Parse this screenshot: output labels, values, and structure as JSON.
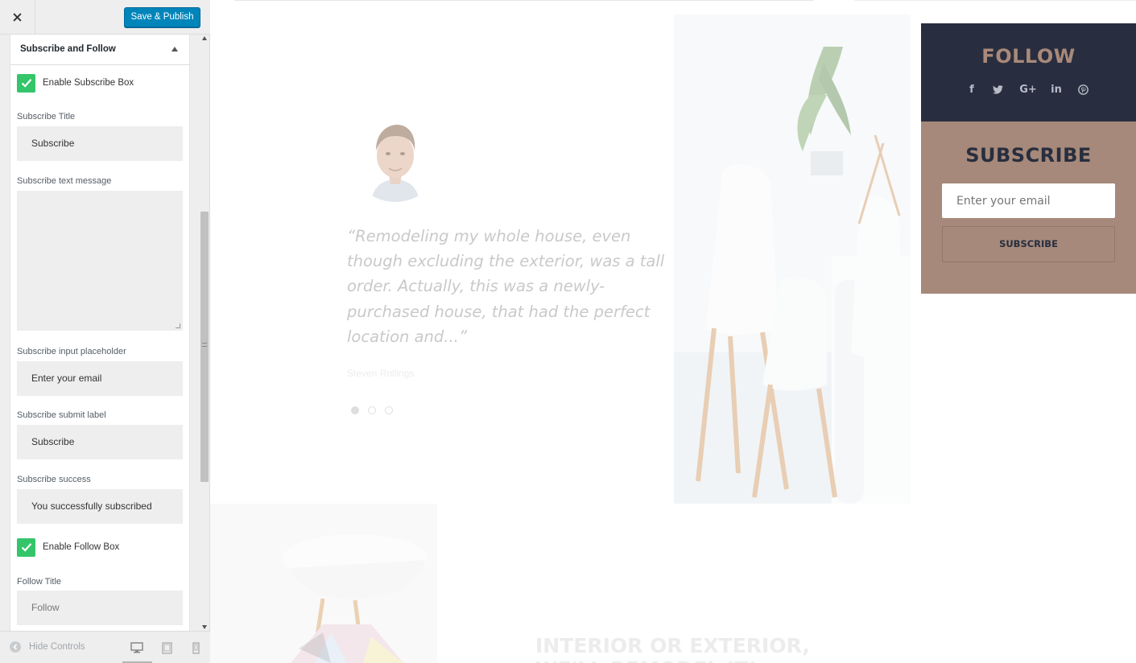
{
  "app": {
    "close_icon": "close-icon",
    "publish_label": "Save & Publish"
  },
  "section": {
    "title": "Subscribe and Follow"
  },
  "fields": {
    "enable_subscribe_label": "Enable Subscribe Box",
    "subscribe_title_label": "Subscribe Title",
    "subscribe_title_value": "Subscribe",
    "subscribe_text_label": "Subscribe text message",
    "subscribe_text_value": "",
    "placeholder_label": "Subscribe input placeholder",
    "placeholder_value": "Enter your email",
    "submit_label_label": "Subscribe submit label",
    "submit_label_value": "Subscribe",
    "success_label": "Subscribe success",
    "success_value": "You successfully subscribed",
    "enable_follow_label": "Enable Follow Box",
    "follow_title_label": "Follow Title",
    "follow_title_value": "Follow"
  },
  "footer": {
    "hide_controls_label": "Hide Controls",
    "devices": [
      "desktop-icon",
      "tablet-icon",
      "mobile-icon"
    ]
  },
  "preview": {
    "testimonial_quote": "“Remodeling my whole house, even though excluding the exterior, was a tall order. Actually, this was a newly-purchased house, that had the perfect location and...”",
    "testimonial_author": "Steven Rollings",
    "heading_line1": "INTERIOR OR EXTERIOR,",
    "heading_line2": "WE'LL REMODEL IT!"
  },
  "widget": {
    "follow_title": "FOLLOW",
    "social_icons": [
      "facebook-icon",
      "twitter-icon",
      "google-plus-icon",
      "linkedin-icon",
      "pinterest-icon"
    ],
    "social_glyphs": {
      "facebook": "f",
      "google": "G+",
      "linkedin": "in"
    },
    "subscribe_title": "SUBSCRIBE",
    "email_placeholder": "Enter your email",
    "subscribe_button": "SUBSCRIBE"
  },
  "colors": {
    "publish": "#0085ba",
    "checkbox": "#34c56a",
    "follow_bg": "#282e3f",
    "subscribe_bg": "#a6897a"
  }
}
